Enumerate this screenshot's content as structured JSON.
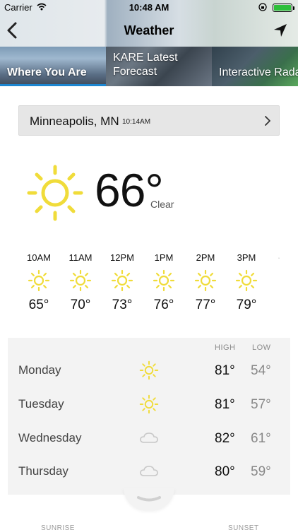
{
  "status_bar": {
    "carrier": "Carrier",
    "time": "10:48 AM"
  },
  "nav": {
    "title": "Weather"
  },
  "tabs": [
    {
      "label": "Where You Are",
      "active": true
    },
    {
      "label_line1": "KARE Latest",
      "label_line2": "Forecast"
    },
    {
      "label": "Interactive Radar"
    }
  ],
  "location": {
    "city": "Minneapolis, MN",
    "updated": "10:14AM"
  },
  "current": {
    "temp": "66°",
    "condition": "Clear",
    "icon": "sun-icon"
  },
  "hourly": [
    {
      "time": "10AM",
      "temp": "65°",
      "icon": "sun-icon"
    },
    {
      "time": "11AM",
      "temp": "70°",
      "icon": "sun-icon"
    },
    {
      "time": "12PM",
      "temp": "73°",
      "icon": "sun-icon"
    },
    {
      "time": "1PM",
      "temp": "76°",
      "icon": "sun-icon"
    },
    {
      "time": "2PM",
      "temp": "77°",
      "icon": "sun-icon"
    },
    {
      "time": "3PM",
      "temp": "79°",
      "icon": "sun-icon"
    }
  ],
  "daily": {
    "high_header": "HIGH",
    "low_header": "LOW",
    "days": [
      {
        "name": "Monday",
        "high": "81°",
        "low": "54°",
        "icon": "sun-icon"
      },
      {
        "name": "Tuesday",
        "high": "81°",
        "low": "57°",
        "icon": "sun-icon"
      },
      {
        "name": "Wednesday",
        "high": "82°",
        "low": "61°",
        "icon": "cloud-icon"
      },
      {
        "name": "Thursday",
        "high": "80°",
        "low": "59°",
        "icon": "cloud-icon"
      }
    ]
  },
  "bottom": {
    "sunrise": "SUNRISE",
    "sunset": "SUNSET"
  },
  "colors": {
    "sun": "#f0dc3a",
    "accent": "#1c86d1",
    "cloud": "#c8c8c8"
  }
}
